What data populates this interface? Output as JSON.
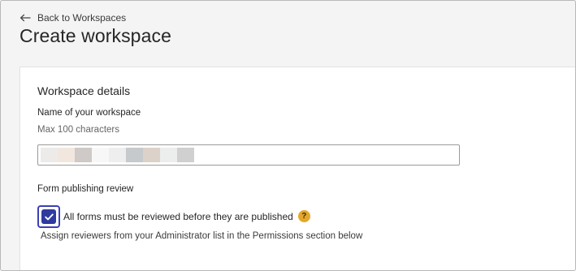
{
  "header": {
    "back_label": "Back to Workspaces",
    "back_icon": "arrow-left-icon",
    "title": "Create workspace"
  },
  "workspace_details": {
    "section_title": "Workspace details",
    "name_label": "Name of your workspace",
    "name_hint": "Max 100 characters",
    "name_value_redacted": true,
    "redaction_colors": [
      "#ecebea",
      "#f2e7de",
      "#cfc9c7",
      "#f7f7f7",
      "#eeeeee",
      "#c6cacd",
      "#dcd2ca",
      "#eceded",
      "#d0d0d1"
    ]
  },
  "review": {
    "label": "Form publishing review",
    "checkbox_checked": true,
    "checkbox_label": "All forms must be reviewed before they are published",
    "help_icon": "question-circle-icon",
    "help_glyph": "?",
    "assign_text": "Assign reviewers from your Administrator list in the Permissions section below"
  },
  "colors": {
    "accent": "#2e3a9f",
    "help_badge": "#e3a82b",
    "page_bg": "#f4f4f4",
    "card_bg": "#ffffff"
  }
}
